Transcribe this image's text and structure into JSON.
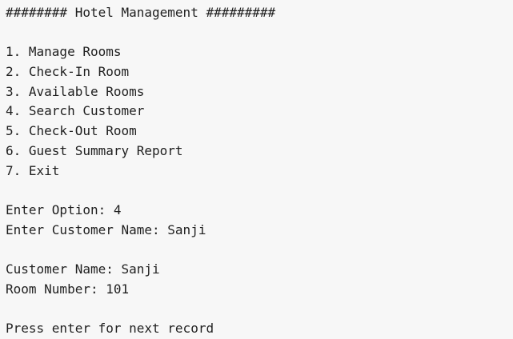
{
  "console": {
    "title": "######## Hotel Management #########",
    "menu": [
      "1. Manage Rooms",
      "2. Check-In Room",
      "3. Available Rooms",
      "4. Search Customer",
      "5. Check-Out Room",
      "6. Guest Summary Report",
      "7. Exit"
    ],
    "option_prompt": "Enter Option: 4",
    "name_prompt": "Enter Customer Name: Sanji",
    "result_name": "Customer Name: Sanji",
    "result_room": "Room Number: 101",
    "continue_prompt": "Press enter for next record"
  }
}
